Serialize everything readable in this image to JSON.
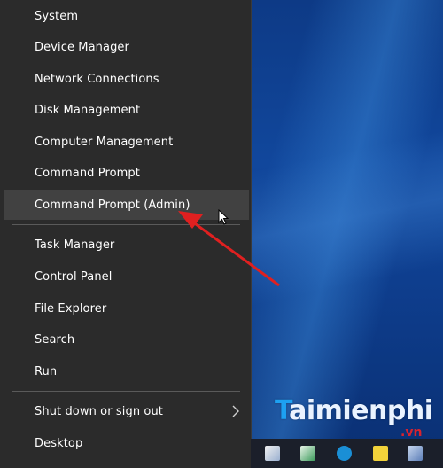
{
  "menu": {
    "items": [
      {
        "label": "System"
      },
      {
        "label": "Device Manager"
      },
      {
        "label": "Network Connections"
      },
      {
        "label": "Disk Management"
      },
      {
        "label": "Computer Management"
      },
      {
        "label": "Command Prompt"
      },
      {
        "label": "Command Prompt (Admin)"
      },
      {
        "label": "Task Manager"
      },
      {
        "label": "Control Panel"
      },
      {
        "label": "File Explorer"
      },
      {
        "label": "Search"
      },
      {
        "label": "Run"
      },
      {
        "label": "Shut down or sign out"
      },
      {
        "label": "Desktop"
      }
    ],
    "highlighted_item": "Command Prompt (Admin)"
  },
  "watermark": {
    "brand": "aimienphi",
    "brand_initial": "T",
    "suffix": ".vn"
  },
  "colors": {
    "menu_bg": "#2b2b2b",
    "highlight_bg": "#414141",
    "arrow": "#e02020",
    "desktop": "#0d3a86"
  }
}
